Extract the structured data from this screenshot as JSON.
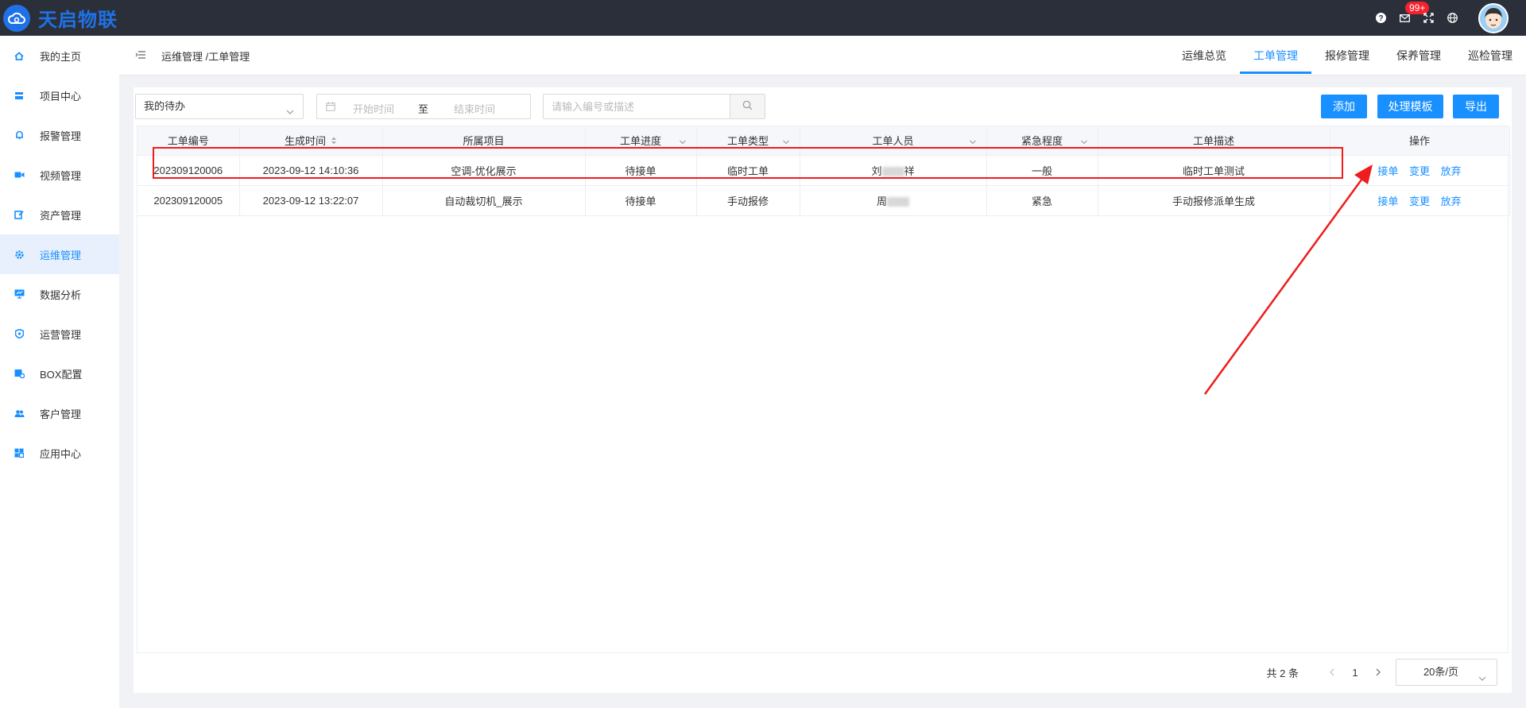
{
  "app": {
    "name": "天启物联",
    "notification_count": "99+"
  },
  "icons": {
    "logo": "cloud-logo-icon",
    "help": "help-icon",
    "mail": "mail-icon",
    "fullscreen": "fullscreen-icon",
    "language": "globe-icon",
    "menu_toggle": "menu-fold-icon",
    "calendar": "calendar-icon",
    "search": "search-icon"
  },
  "colors": {
    "primary": "#1890ff",
    "topbar": "#2b2f3a",
    "logo": "#1f72e6",
    "annotation": "#ee1c1c"
  },
  "sidebar": {
    "items": [
      {
        "label": "我的主页",
        "icon": "home-icon"
      },
      {
        "label": "项目中心",
        "icon": "layers-icon"
      },
      {
        "label": "报警管理",
        "icon": "bell-icon"
      },
      {
        "label": "视频管理",
        "icon": "video-icon"
      },
      {
        "label": "资产管理",
        "icon": "asset-icon"
      },
      {
        "label": "运维管理",
        "icon": "gear-icon",
        "active": true
      },
      {
        "label": "数据分析",
        "icon": "monitor-chart-icon"
      },
      {
        "label": "运营管理",
        "icon": "shield-icon"
      },
      {
        "label": "BOX配置",
        "icon": "box-settings-icon"
      },
      {
        "label": "客户管理",
        "icon": "users-icon"
      },
      {
        "label": "应用中心",
        "icon": "apps-icon"
      }
    ]
  },
  "header": {
    "breadcrumb": "运维管理 /工单管理",
    "tabs": [
      {
        "label": "运维总览"
      },
      {
        "label": "工单管理",
        "active": true
      },
      {
        "label": "报修管理"
      },
      {
        "label": "保养管理"
      },
      {
        "label": "巡检管理"
      }
    ]
  },
  "filters": {
    "scope_value": "我的待办",
    "date_start_placeholder": "开始时间",
    "date_separator": "至",
    "date_end_placeholder": "结束时间",
    "search_placeholder": "请输入编号或描述"
  },
  "toolbar": {
    "add_label": "添加",
    "template_label": "处理模板",
    "export_label": "导出"
  },
  "table": {
    "columns": [
      "工单编号",
      "生成时间",
      "所属项目",
      "工单进度",
      "工单类型",
      "工单人员",
      "紧急程度",
      "工单描述",
      "操作"
    ],
    "rows": [
      {
        "id": "202309120006",
        "time": "2023-09-12 14:10:36",
        "project": "空调-优化展示",
        "progress": "待接单",
        "type": "临时工单",
        "person_visible": "刘",
        "person_visible_end": "祥",
        "urgency": "一般",
        "desc": "临时工单测试",
        "actions": [
          "接单",
          "变更",
          "放弃"
        ]
      },
      {
        "id": "202309120005",
        "time": "2023-09-12 13:22:07",
        "project": "自动裁切机_展示",
        "progress": "待接单",
        "type": "手动报修",
        "person_visible": "周",
        "person_visible_end": "",
        "urgency": "紧急",
        "desc": "手动报修派单生成",
        "actions": [
          "接单",
          "变更",
          "放弃"
        ]
      }
    ]
  },
  "pagination": {
    "total": "共 2 条",
    "current_page": "1",
    "page_size": "20条/页"
  }
}
